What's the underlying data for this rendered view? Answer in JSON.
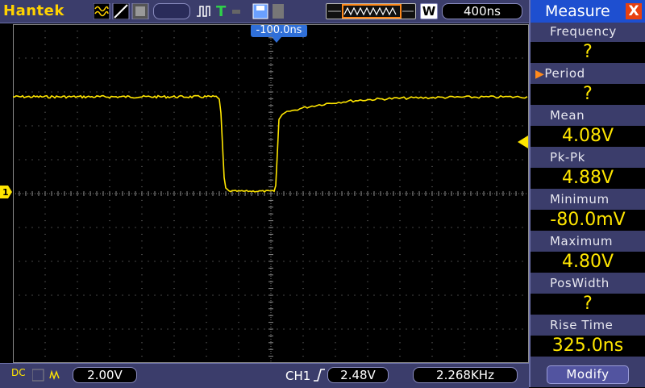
{
  "topbar": {
    "brand": "Hantek",
    "timebase": "400ns",
    "window_mode": "W",
    "trigger_position": "-100.0ns"
  },
  "bottombar": {
    "ch1_volts_div": "2.00V",
    "trigger_channel": "CH1",
    "trigger_level": "2.48V",
    "frequency": "2.268KHz",
    "coupling": "DC"
  },
  "plot": {
    "channel_marker": "1",
    "trace_color": "#ffe600"
  },
  "measure": {
    "title": "Measure",
    "close_glyph": "X",
    "items": [
      {
        "label": "Frequency",
        "value": "?"
      },
      {
        "label": "Period",
        "value": "?"
      },
      {
        "label": "Mean",
        "value": "4.08V"
      },
      {
        "label": "Pk-Pk",
        "value": "4.88V"
      },
      {
        "label": "Minimum",
        "value": "-80.0mV"
      },
      {
        "label": "Maximum",
        "value": "4.80V"
      },
      {
        "label": "PosWidth",
        "value": "?"
      },
      {
        "label": "Rise Time",
        "value": "325.0ns"
      }
    ],
    "modify_label": "Modify"
  }
}
